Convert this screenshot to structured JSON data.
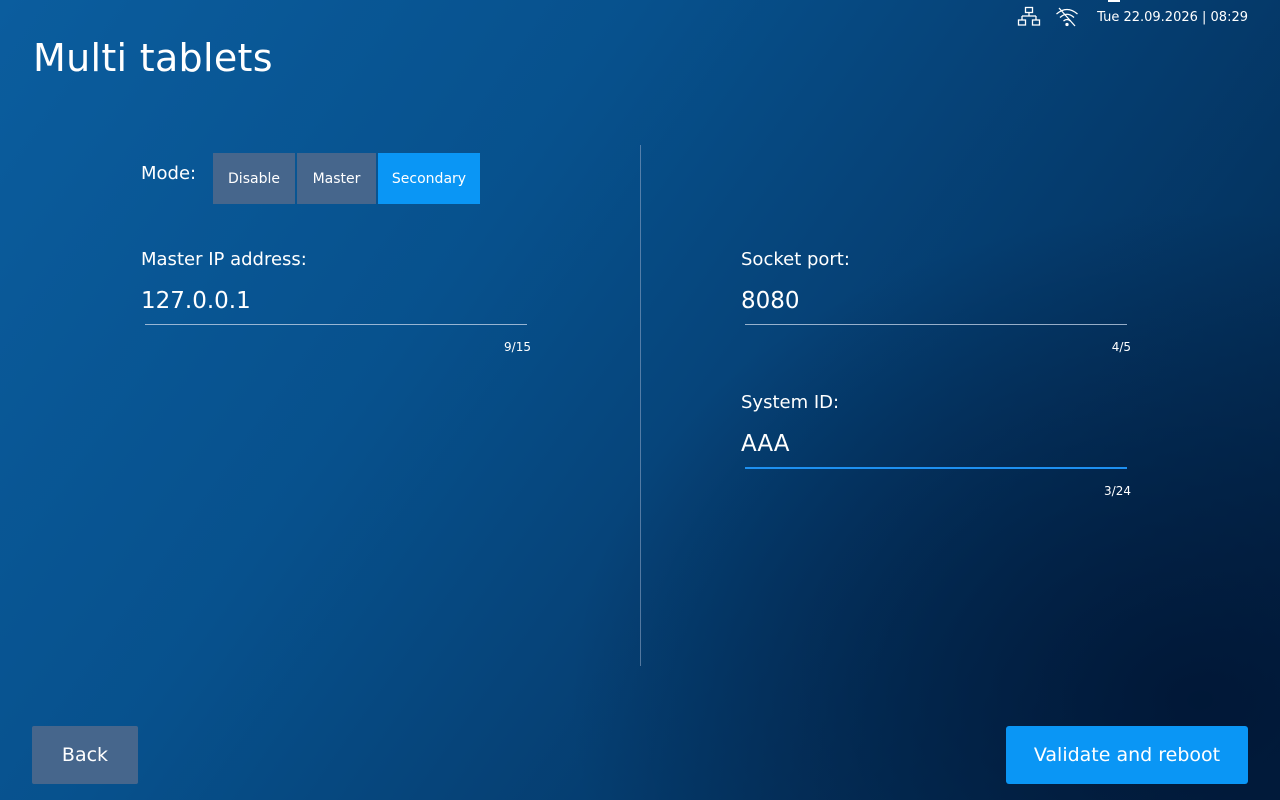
{
  "header": {
    "title": "Multi tablets",
    "datetime": "Tue 22.09.2026 | 08:29",
    "icons": [
      "network-icon",
      "wifi-off-icon"
    ]
  },
  "mode": {
    "label": "Mode:",
    "options": [
      "Disable",
      "Master",
      "Secondary"
    ],
    "selected": "Secondary"
  },
  "fields": {
    "master_ip": {
      "label": "Master IP address:",
      "value": "127.0.0.1",
      "counter": "9/15"
    },
    "socket_port": {
      "label": "Socket port:",
      "value": "8080",
      "counter": "4/5"
    },
    "system_id": {
      "label": "System ID:",
      "value": "AAA",
      "counter": "3/24"
    }
  },
  "footer": {
    "back_label": "Back",
    "validate_label": "Validate and reboot"
  },
  "colors": {
    "accent": "#0a96f5",
    "button_inactive": "#46668c",
    "focus_underline": "#1e90f0"
  }
}
